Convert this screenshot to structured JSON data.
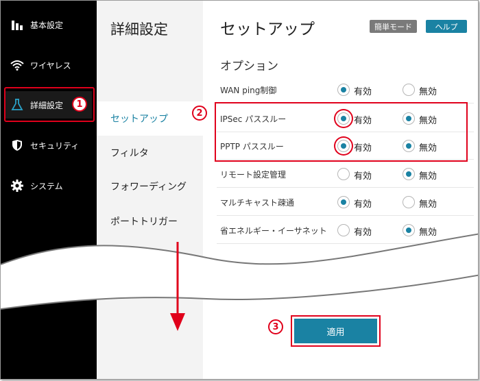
{
  "sidebar": {
    "items": [
      {
        "label": "基本設定",
        "icon": "bar-chart-icon"
      },
      {
        "label": "ワイヤレス",
        "icon": "wifi-icon"
      },
      {
        "label": "詳細設定",
        "icon": "flask-icon"
      },
      {
        "label": "セキュリティ",
        "icon": "shield-icon"
      },
      {
        "label": "システム",
        "icon": "gear-icon"
      }
    ]
  },
  "submenu": {
    "title": "詳細設定",
    "items": [
      "セットアップ",
      "フィルタ",
      "フォワーディング",
      "ポートトリガー"
    ]
  },
  "main": {
    "title": "セットアップ",
    "simple_mode": "簡単モード",
    "help": "ヘルプ",
    "section": "オプション",
    "enable_label": "有効",
    "disable_label": "無効",
    "options": [
      {
        "label": "WAN ping制御",
        "value": "有効"
      },
      {
        "label": "IPSec パススルー",
        "value": "有効"
      },
      {
        "label": "PPTP パススルー",
        "value": "有効"
      },
      {
        "label": "リモート設定管理",
        "value": "無効"
      },
      {
        "label": "マルチキャスト疎通",
        "value": "有効"
      },
      {
        "label": "省エネルギー・イーサネット",
        "value": "無効"
      }
    ],
    "apply": "適用"
  },
  "annotations": {
    "step1": "1",
    "step2": "2",
    "step3": "3"
  },
  "colors": {
    "accent": "#1a82a3",
    "highlight": "#e0001b",
    "sidebar_bg": "#000000",
    "submenu_bg": "#f3f3f3"
  }
}
